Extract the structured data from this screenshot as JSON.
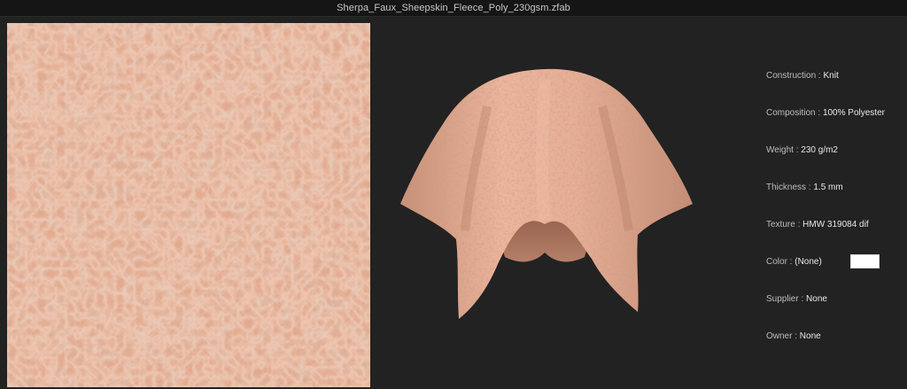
{
  "window": {
    "title": "Sherpa_Faux_Sheepskin_Fleece_Poly_230gsm.zfab"
  },
  "properties": [
    {
      "key": "construction",
      "label": "Construction",
      "value": "Knit"
    },
    {
      "key": "composition",
      "label": "Composition",
      "value": "100% Polyester"
    },
    {
      "key": "weight",
      "label": "Weight",
      "value": "230 g/m2"
    },
    {
      "key": "thickness",
      "label": "Thickness",
      "value": "1.5 mm"
    },
    {
      "key": "texture",
      "label": "Texture",
      "value": "HMW 319084 dif"
    },
    {
      "key": "color",
      "label": "Color",
      "value": "(None)",
      "swatch_color": "#ffffff"
    },
    {
      "key": "supplier",
      "label": "Supplier",
      "value": "None"
    },
    {
      "key": "owner",
      "label": "Owner",
      "value": "None"
    }
  ],
  "colors": {
    "background": "#222222",
    "titlebar": "#151515",
    "fabric_base": "#e2ab90",
    "fabric_shadow": "#b97d63",
    "fabric_highlight": "#f0c2aa"
  },
  "icons": {
    "swatch": "fabric-texture-swatch",
    "drape": "draped-fabric-preview"
  }
}
